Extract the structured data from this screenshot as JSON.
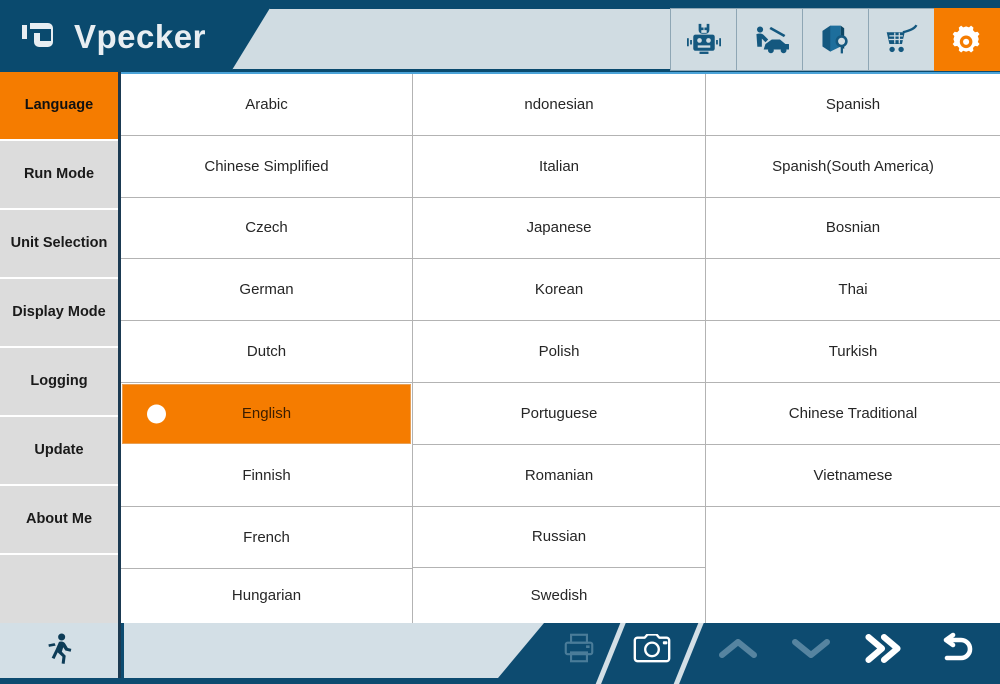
{
  "app": {
    "brand_name": "Vpecker",
    "logo_icon": "vpecker-logo-icon",
    "accent_color": "#f57c00",
    "header_color": "#0a4a6e",
    "panel_color": "#d0dce2"
  },
  "header": {
    "icons": [
      {
        "name": "diagnostic-scan-icon",
        "label": "Diagnostic Scan",
        "active": false
      },
      {
        "name": "car-repair-icon",
        "label": "Car Repair",
        "active": false
      },
      {
        "name": "book-search-icon",
        "label": "Library Lookup",
        "active": false
      },
      {
        "name": "shopping-cart-icon",
        "label": "Shop",
        "active": false
      },
      {
        "name": "settings-gear-icon",
        "label": "Settings",
        "active": true
      }
    ]
  },
  "sidebar": {
    "items": [
      {
        "label": "Language",
        "active": true
      },
      {
        "label": "Run Mode",
        "active": false
      },
      {
        "label": "Unit Selection",
        "active": false
      },
      {
        "label": "Display Mode",
        "active": false
      },
      {
        "label": "Logging",
        "active": false
      },
      {
        "label": "Update",
        "active": false
      },
      {
        "label": "About Me",
        "active": false
      }
    ]
  },
  "language_grid": {
    "columns": [
      {
        "cells": [
          {
            "label": "Arabic",
            "selected": false
          },
          {
            "label": "Chinese Simplified",
            "selected": false
          },
          {
            "label": "Czech",
            "selected": false
          },
          {
            "label": "German",
            "selected": false
          },
          {
            "label": "Dutch",
            "selected": false
          },
          {
            "label": "English",
            "selected": true
          },
          {
            "label": "Finnish",
            "selected": false
          },
          {
            "label": "French",
            "selected": false
          },
          {
            "label": "Hungarian",
            "selected": false
          }
        ]
      },
      {
        "cells": [
          {
            "label": "ndonesian",
            "selected": false
          },
          {
            "label": "Italian",
            "selected": false
          },
          {
            "label": "Japanese",
            "selected": false
          },
          {
            "label": "Korean",
            "selected": false
          },
          {
            "label": "Polish",
            "selected": false
          },
          {
            "label": "Portuguese",
            "selected": false
          },
          {
            "label": "Romanian",
            "selected": false
          },
          {
            "label": "Russian",
            "selected": false
          },
          {
            "label": "Swedish",
            "selected": false
          }
        ]
      },
      {
        "cells": [
          {
            "label": "Spanish",
            "selected": false
          },
          {
            "label": "Spanish(South America)",
            "selected": false
          },
          {
            "label": "Bosnian",
            "selected": false
          },
          {
            "label": "Thai",
            "selected": false
          },
          {
            "label": "Turkish",
            "selected": false
          },
          {
            "label": "Chinese Traditional",
            "selected": false
          },
          {
            "label": "Vietnamese",
            "selected": false
          }
        ]
      }
    ]
  },
  "footer": {
    "buttons": [
      {
        "name": "run-icon",
        "label": "Run",
        "enabled": true
      },
      {
        "name": "printer-icon",
        "label": "Print",
        "enabled": false
      },
      {
        "name": "camera-icon",
        "label": "Screenshot",
        "enabled": true
      },
      {
        "name": "chevron-up-icon",
        "label": "Scroll Up",
        "enabled": false
      },
      {
        "name": "chevron-down-icon",
        "label": "Scroll Down",
        "enabled": false
      },
      {
        "name": "double-chevron-right-icon",
        "label": "Next",
        "enabled": true
      },
      {
        "name": "back-arrow-icon",
        "label": "Back",
        "enabled": true
      }
    ]
  }
}
